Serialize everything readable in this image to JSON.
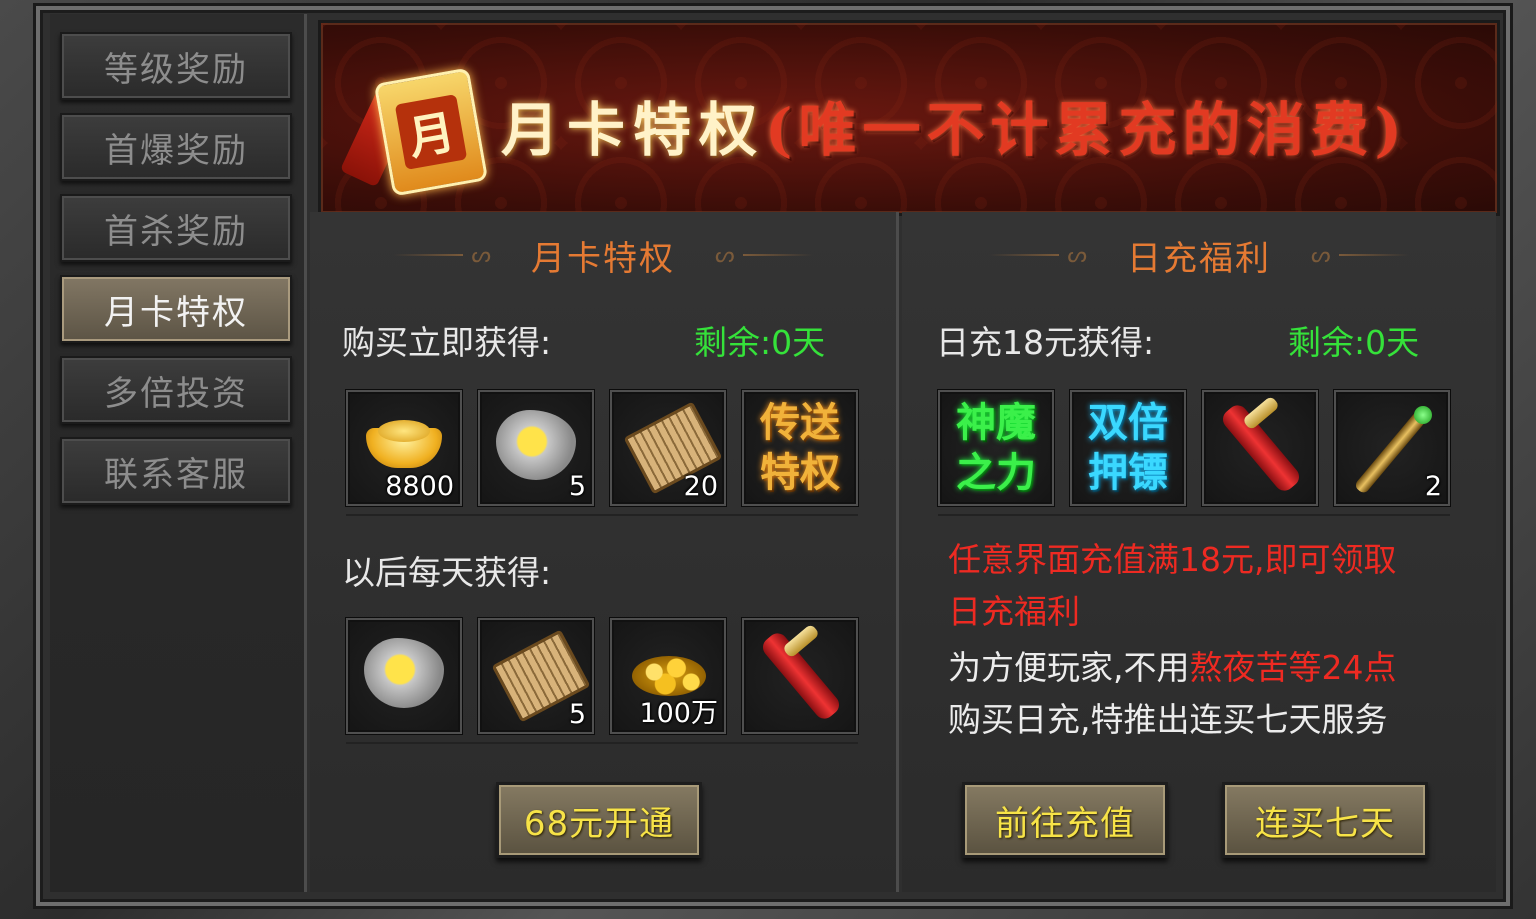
{
  "sidebar": {
    "items": [
      {
        "label": "等级奖励"
      },
      {
        "label": "首爆奖励"
      },
      {
        "label": "首杀奖励"
      },
      {
        "label": "月卡特权"
      },
      {
        "label": "多倍投资"
      },
      {
        "label": "联系客服"
      }
    ],
    "active": "月卡特权"
  },
  "banner": {
    "card_glyph": "月",
    "title": "月卡特权",
    "subtitle": "(唯一不计累充的消费)"
  },
  "monthly": {
    "title": "月卡特权",
    "buy_label": "购买立即获得:",
    "remain": "剩余:0天",
    "instant_items": [
      {
        "icon": "gold-ingot-icon",
        "count": "8800"
      },
      {
        "icon": "ore-icon",
        "count": "5"
      },
      {
        "icon": "scroll-doc-icon",
        "count": "20"
      },
      {
        "icon": "teleport-privilege-icon",
        "text": "传送特权"
      }
    ],
    "daily_label": "以后每天获得:",
    "daily_items": [
      {
        "icon": "ore-icon",
        "count": ""
      },
      {
        "icon": "scroll-doc-icon",
        "count": "5"
      },
      {
        "icon": "gold-coins-icon",
        "count": "100万"
      },
      {
        "icon": "red-scroll-icon",
        "count": ""
      }
    ],
    "button": "68元开通"
  },
  "daily_recharge": {
    "title": "日充福利",
    "label": "日充18元获得:",
    "remain": "剩余:0天",
    "items": [
      {
        "icon": "god-demon-power-icon",
        "text": "神魔之力"
      },
      {
        "icon": "double-escort-icon",
        "text": "双倍押镖"
      },
      {
        "icon": "red-scroll-icon",
        "count": ""
      },
      {
        "icon": "jade-rod-icon",
        "count": "2"
      }
    ],
    "notice_line1": "任意界面充值满18元,即可领取",
    "notice_line2": "日充福利",
    "desc_line1_a": "为方便玩家,不用",
    "desc_line1_b": "熬夜苦等24点",
    "desc_line2": "购买日充,特推出连买七天服务",
    "btn_recharge": "前往充值",
    "btn_seven": "连买七天"
  },
  "colors": {
    "title_orange": "#e57a33",
    "remain_green": "#35e23a",
    "notice_red": "#ee2a22",
    "button_text": "#f7e347"
  }
}
